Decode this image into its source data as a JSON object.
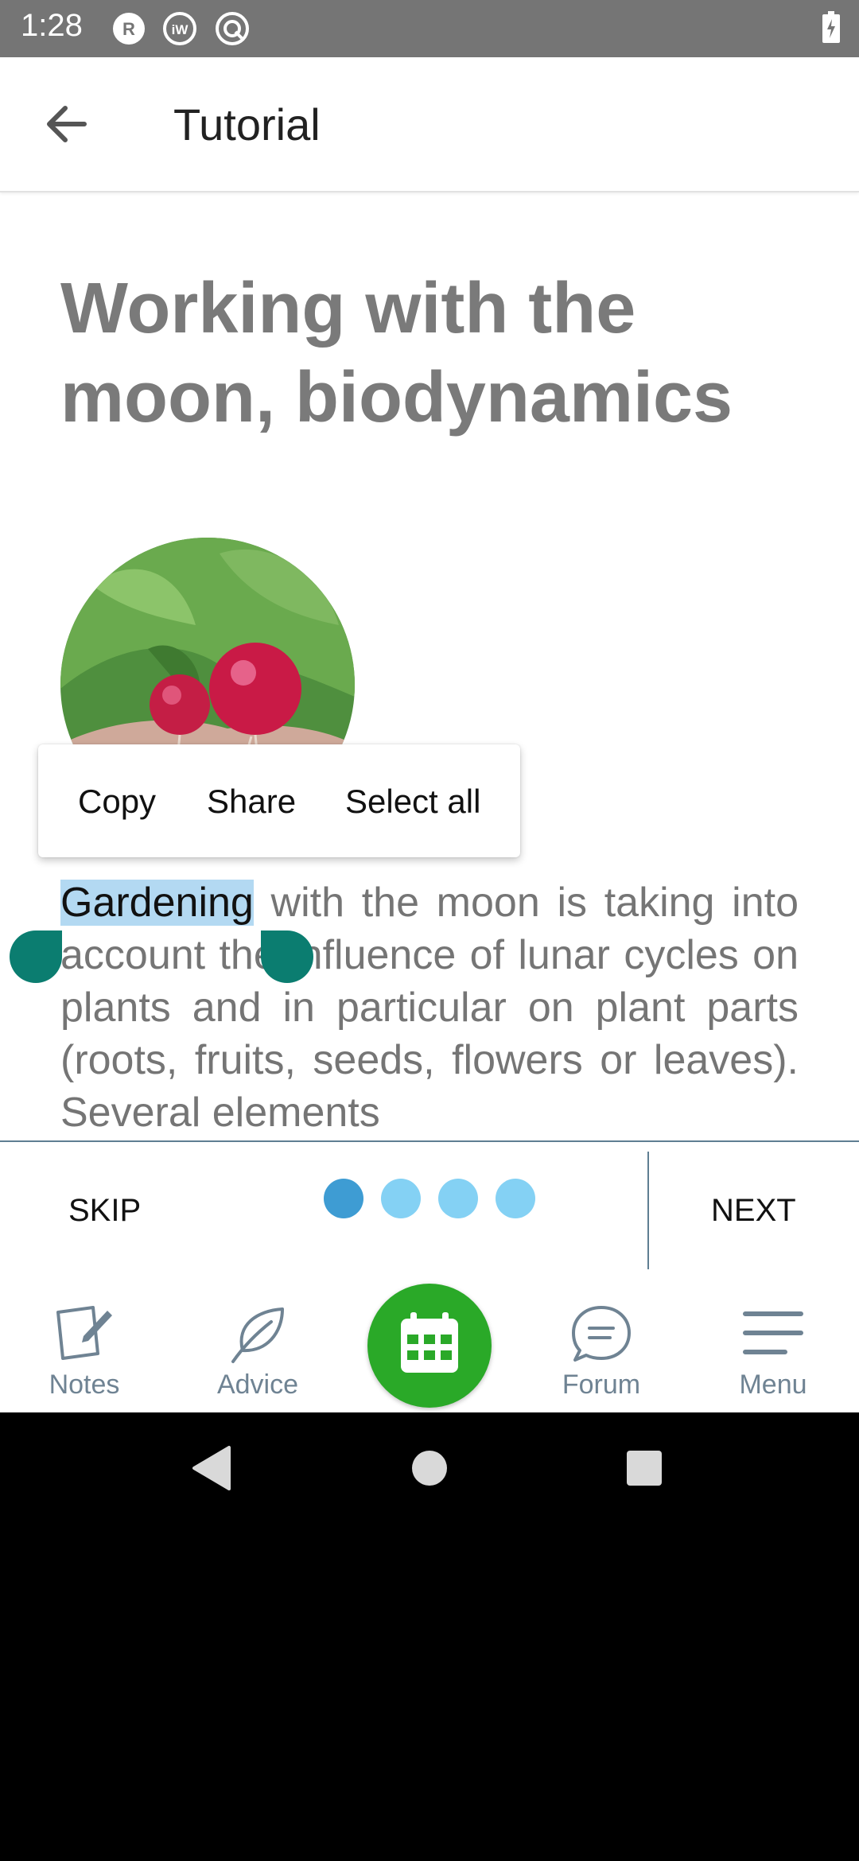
{
  "status_bar": {
    "time": "1:28",
    "icons": [
      "r-badge-icon",
      "iw-badge-icon",
      "sync-badge-icon",
      "battery-charging-icon"
    ],
    "badge_r": "R",
    "badge_iw": "iW"
  },
  "app_bar": {
    "title": "Tutorial",
    "back_icon": "arrow-back-icon"
  },
  "article": {
    "headline": "Working with the moon, biodynamics",
    "image_description": "radishes held in a hand",
    "selected_word": "Gardening",
    "body_rest": " with the moon is taking into account the influence of lunar cycles on plants and in particular on plant parts (roots, fruits, seeds, flowers or leaves). Several elements"
  },
  "context_menu": {
    "items": [
      "Copy",
      "Share",
      "Select all"
    ]
  },
  "tutorial_footer": {
    "skip_label": "SKIP",
    "next_label": "NEXT",
    "pages_total": 4,
    "current_page": 1
  },
  "bottom_nav": {
    "items": [
      {
        "label": "Notes",
        "icon": "notes-icon"
      },
      {
        "label": "Advice",
        "icon": "leaf-icon"
      },
      {
        "label": "",
        "icon": "calendar-icon"
      },
      {
        "label": "Forum",
        "icon": "chat-bubble-icon"
      },
      {
        "label": "Menu",
        "icon": "hamburger-menu-icon"
      }
    ]
  },
  "colors": {
    "accent_green": "#2aa928",
    "selection_handle": "#0b7d70",
    "dot_active": "#3e9cd3",
    "dot_inactive": "#84d1f4",
    "nav_text": "#6f8393"
  }
}
